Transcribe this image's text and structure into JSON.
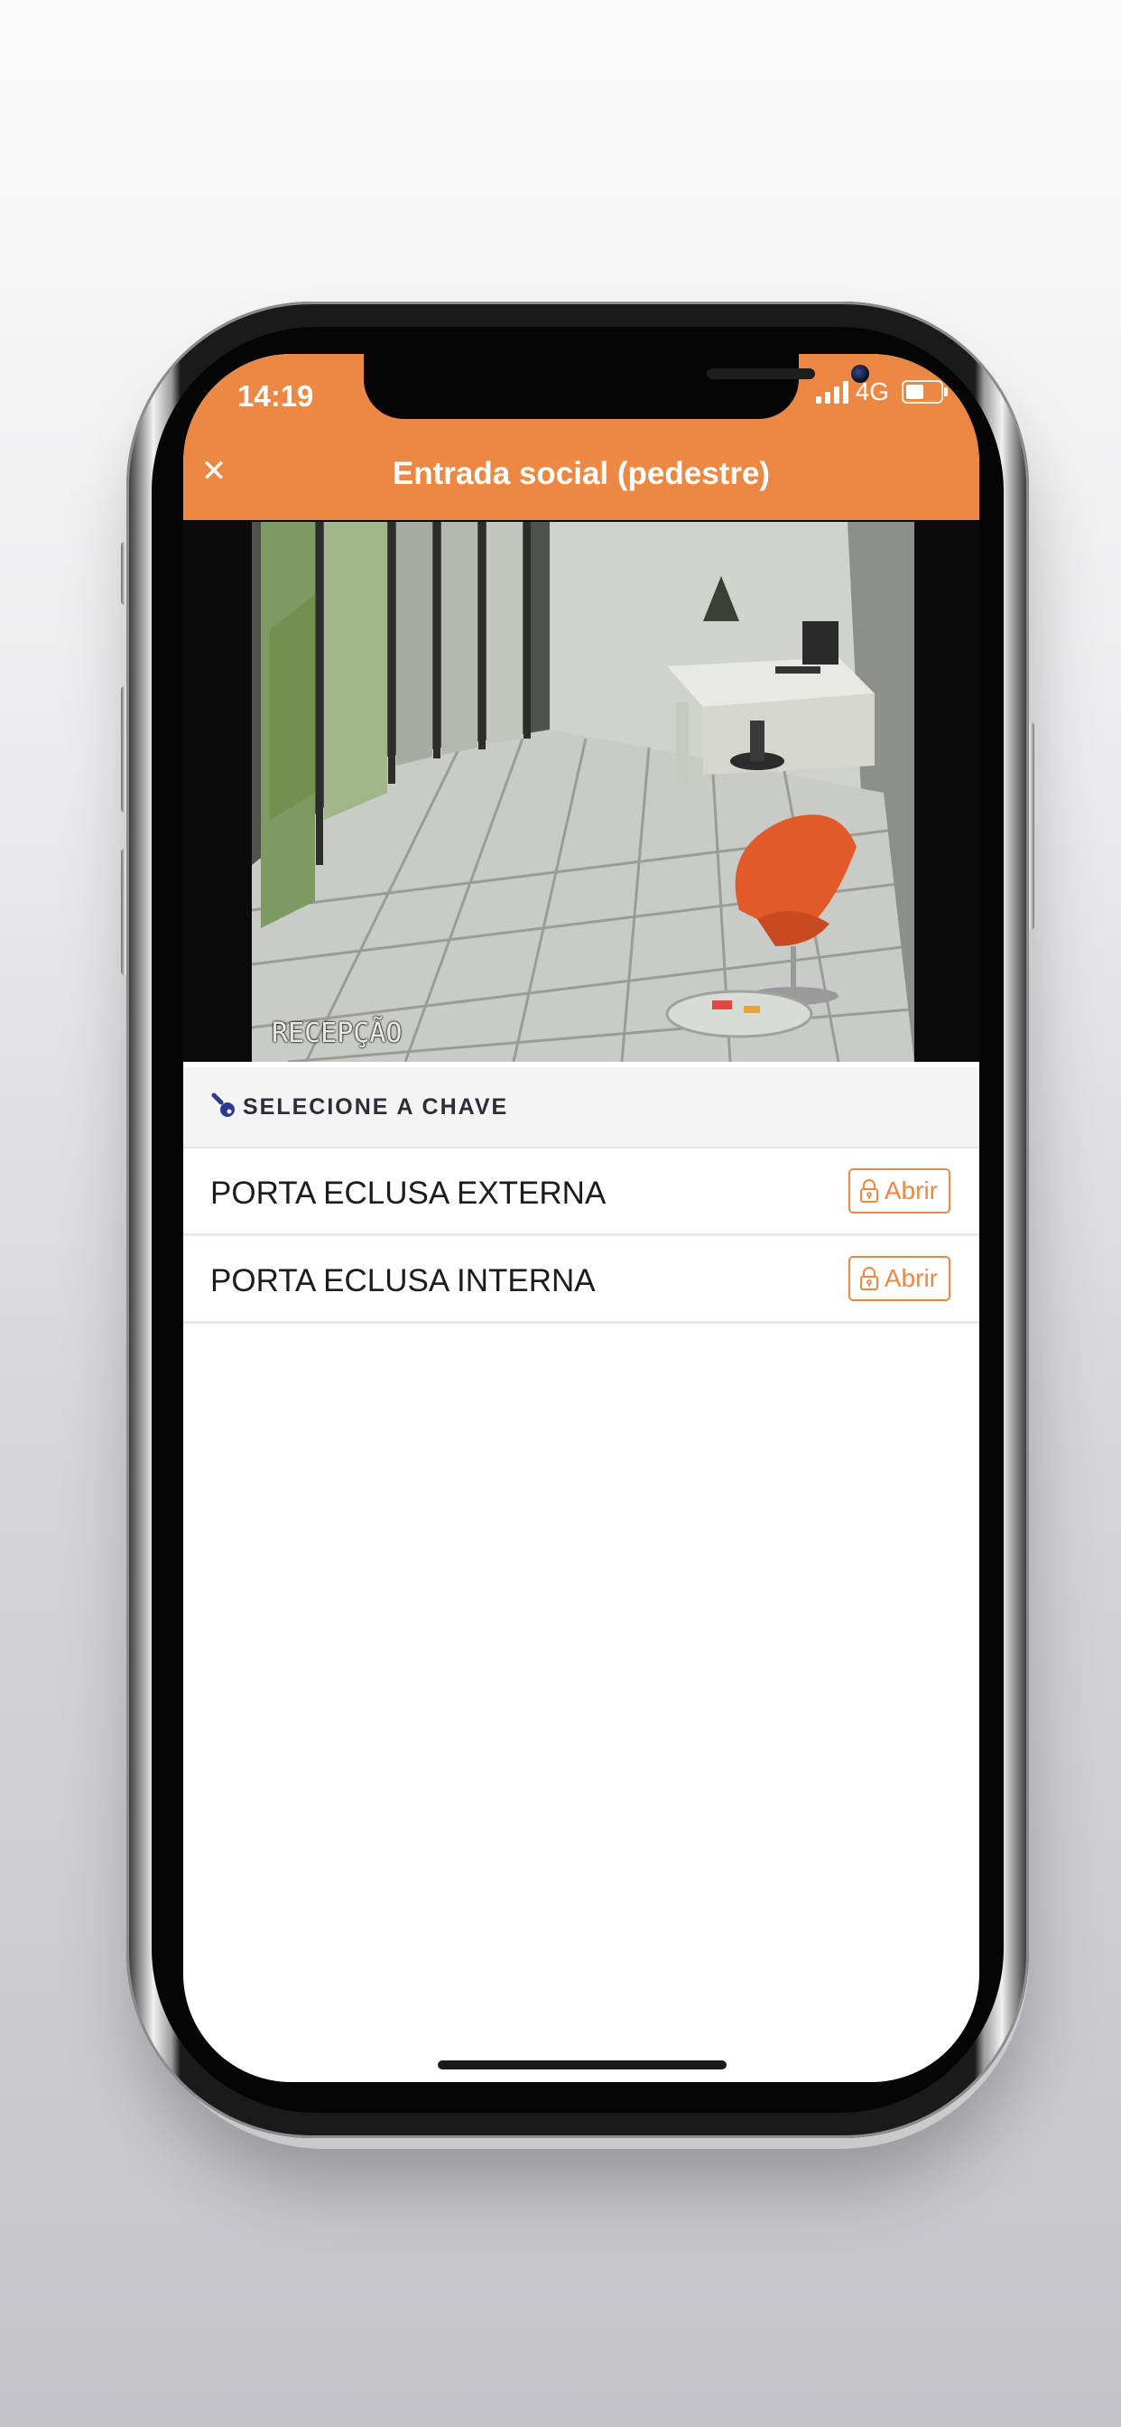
{
  "status_bar": {
    "time": "14:19",
    "network": "4G",
    "battery_level": 0.45,
    "signal_icon": "signal-bars-icon",
    "battery_icon": "battery-icon"
  },
  "header": {
    "title": "Entrada social (pedestre)",
    "close_icon": "close-icon"
  },
  "camera": {
    "overlay_label": "RECEPÇÃO"
  },
  "key_section": {
    "title": "SELECIONE A CHAVE",
    "icon": "key-icon"
  },
  "keys": [
    {
      "name": "PORTA ECLUSA EXTERNA",
      "button_label": "Abrir",
      "button_icon": "lock-icon"
    },
    {
      "name": "PORTA ECLUSA INTERNA",
      "button_label": "Abrir",
      "button_icon": "lock-icon"
    }
  ],
  "colors": {
    "accent": "#ec8843",
    "header_text": "#ffffff",
    "key_icon": "#2b3990",
    "background": "#ffffff"
  }
}
